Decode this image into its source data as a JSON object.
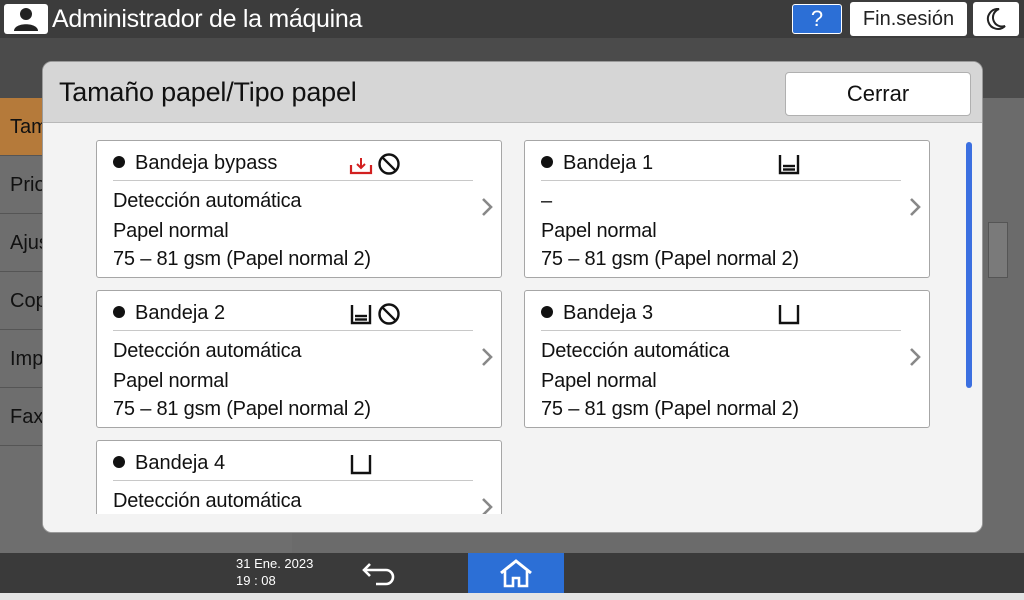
{
  "topbar": {
    "user_icon": "user-icon",
    "title": "Administrador de la máquina",
    "help_label": "?",
    "logout_label": "Fin.sesión",
    "sleep_icon": "moon-icon"
  },
  "background": {
    "tabs": [
      "Tam",
      "Prio",
      "Ajus",
      "Cop",
      "Imp",
      "Fax"
    ]
  },
  "modal": {
    "title": "Tamaño papel/Tipo papel",
    "close_label": "Cerrar",
    "trays": [
      {
        "name": "Bandeja bypass",
        "size": "Detección automática",
        "type": "Papel normal",
        "weight": "75 – 81 gsm (Papel normal 2)",
        "icons": [
          "bypass-tray-icon",
          "prohibited-icon"
        ]
      },
      {
        "name": "Bandeja 1",
        "size": "–",
        "type": "Papel normal",
        "weight": "75 – 81 gsm (Papel normal 2)",
        "icons": [
          "tray-full-icon"
        ]
      },
      {
        "name": "Bandeja 2",
        "size": "Detección automática",
        "type": "Papel normal",
        "weight": "75 – 81 gsm (Papel normal 2)",
        "icons": [
          "tray-full-icon",
          "prohibited-icon"
        ]
      },
      {
        "name": "Bandeja 3",
        "size": "Detección automática",
        "type": "Papel normal",
        "weight": "75 – 81 gsm (Papel normal 2)",
        "icons": [
          "tray-empty-icon"
        ]
      },
      {
        "name": "Bandeja 4",
        "size": "Detección automática",
        "type": "",
        "weight": "",
        "icons": [
          "tray-empty-icon"
        ]
      }
    ]
  },
  "bottombar": {
    "date": "31 Ene. 2023",
    "time": "19 : 08",
    "back_icon": "back-arrow-icon",
    "home_icon": "home-icon"
  },
  "colors": {
    "accent_blue": "#2c6fd6",
    "scrollbar_blue": "#3b6fe0",
    "bypass_red": "#d22020"
  }
}
